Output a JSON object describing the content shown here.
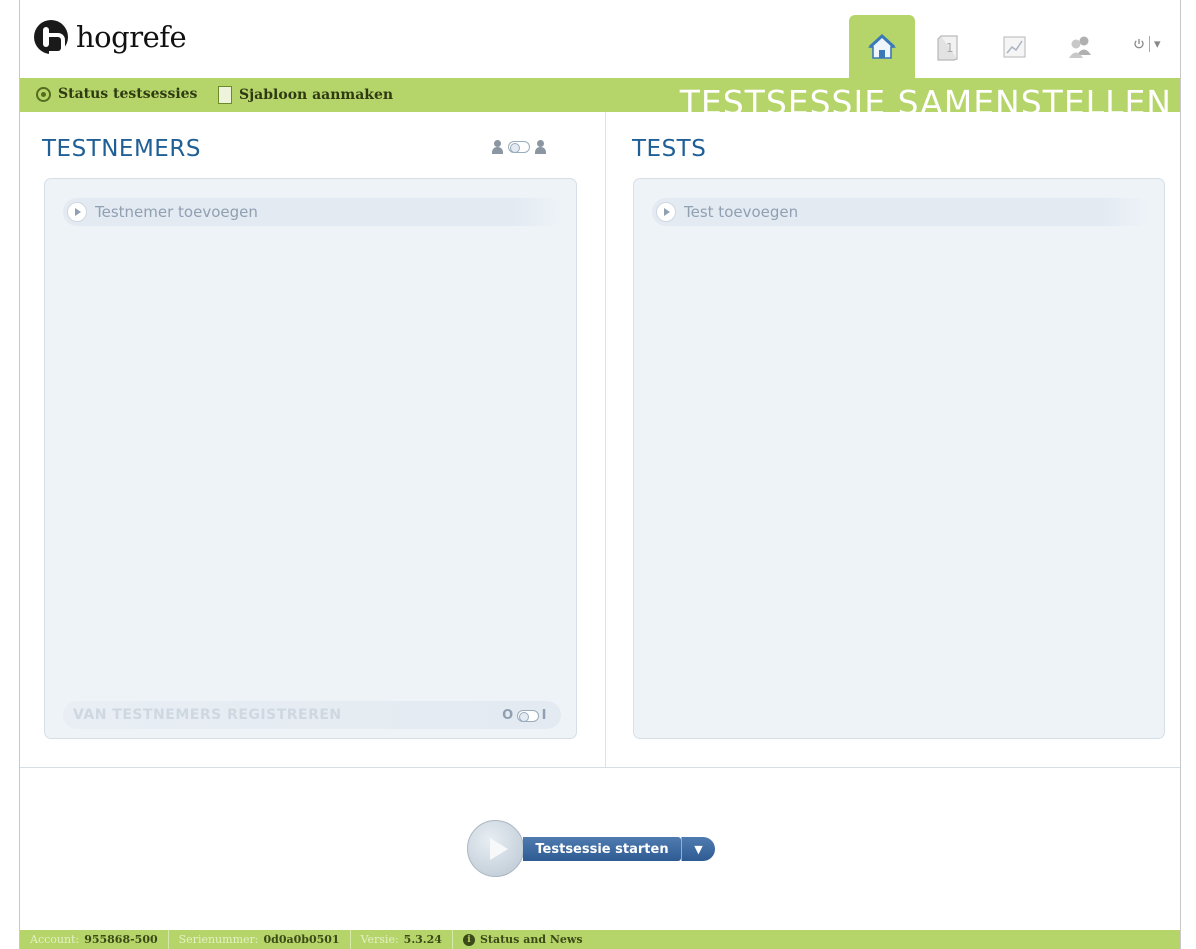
{
  "brand": {
    "name": "hogrefe"
  },
  "nav": {
    "items": [
      {
        "icon": "home-icon",
        "active": true
      },
      {
        "icon": "book-icon",
        "active": false
      },
      {
        "icon": "chart-icon",
        "active": false
      },
      {
        "icon": "users-icon",
        "active": false
      }
    ],
    "power_icon": "power-icon",
    "power_caret": "▾"
  },
  "subbar": {
    "status_label": "Status testsessies",
    "template_label": "Sjabloon aanmaken",
    "page_title": "TESTSESSIE SAMENSTELLEN"
  },
  "left_panel": {
    "title": "TESTNEMERS",
    "add_label": "Testnemer toevoegen",
    "register_label": "VAN TESTNEMERS REGISTREREN",
    "register_toggle_off": "O",
    "register_toggle_on": "I"
  },
  "right_panel": {
    "title": "TESTS",
    "add_label": "Test toevoegen"
  },
  "start": {
    "label": "Testsessie starten",
    "dropdown_glyph": "▼"
  },
  "footer": {
    "account_label": "Account:",
    "account_value": "955868-500",
    "serial_label": "Serienummer:",
    "serial_value": "0d0a0b0501",
    "version_label": "Versie:",
    "version_value": "5.3.24",
    "news_label": "Status and News"
  },
  "colors": {
    "accent_green": "#b5d56a",
    "title_blue": "#1f5f96",
    "button_blue": "#2e5b92"
  }
}
